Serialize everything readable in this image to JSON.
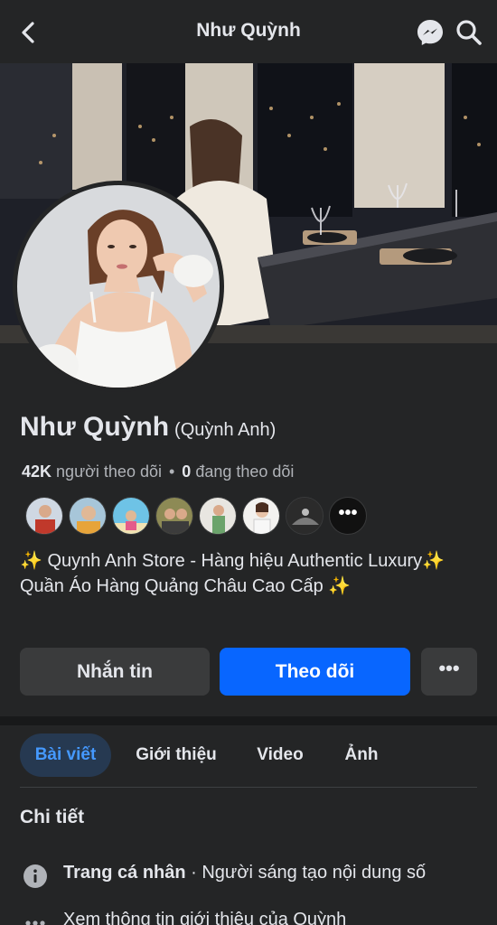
{
  "header": {
    "title": "Như Quỳnh",
    "back_icon": "chevron-left-icon",
    "messenger_icon": "messenger-icon",
    "search_icon": "search-icon"
  },
  "profile": {
    "name": "Như Quỳnh",
    "alt_name": "(Quỳnh Anh)",
    "followers_count": "42K",
    "followers_label": "người theo dõi",
    "separator": "•",
    "following_count": "0",
    "following_label": "đang theo dõi",
    "bio": "✨ Quynh Anh Store - Hàng hiệu Authentic Luxury✨ Quần Áo Hàng Quảng Châu Cao Cấp ✨",
    "more_friends_label": "•••"
  },
  "actions": {
    "message_label": "Nhắn tin",
    "follow_label": "Theo dõi",
    "more_label": "•••"
  },
  "tabs": [
    {
      "label": "Bài viết",
      "active": true
    },
    {
      "label": "Giới thiệu",
      "active": false
    },
    {
      "label": "Video",
      "active": false
    },
    {
      "label": "Ảnh",
      "active": false
    }
  ],
  "details": {
    "title": "Chi tiết",
    "rows": [
      {
        "icon": "info-icon",
        "bold": "Trang cá nhân",
        "text": " · Người sáng tạo nội dung số"
      },
      {
        "icon": "more-icon",
        "bold": "",
        "text": "Xem thông tin giới thiệu của Quỳnh"
      }
    ]
  },
  "colors": {
    "background": "#242526",
    "accent": "#0866ff",
    "active_tab_bg": "#263951",
    "active_tab_text": "#4599ff",
    "button_bg": "#3a3b3c"
  }
}
